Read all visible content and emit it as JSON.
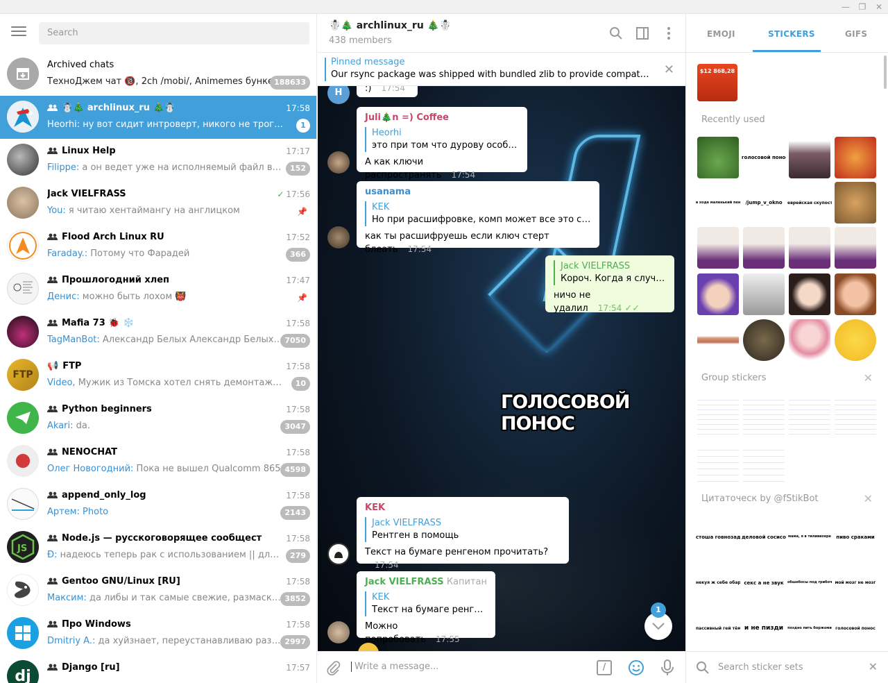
{
  "window": {
    "minimize": "—",
    "maximize": "❐",
    "close": "✕"
  },
  "search": {
    "placeholder": "Search"
  },
  "chats": [
    {
      "title": "Archived chats",
      "preview_sender": "",
      "preview": "ТехноДжем чат 🔞, 2ch /mobi/, Animemes бунке...",
      "time": "",
      "badge": "188633",
      "group": false
    },
    {
      "title": "☃️🎄 archlinux_ru 🎄☃️",
      "preview_sender": "",
      "preview": "Heorhi: ну вот сидит интроверт, никого не трогает. Чер...",
      "time": "17:58",
      "badge": "1",
      "group": true
    },
    {
      "title": "Linux Help",
      "preview_sender": "Filippe:",
      "preview": " а он ведет уже на исполняемый файл в папке ...",
      "time": "17:17",
      "badge": "152",
      "group": true
    },
    {
      "title": "Jack VIELFRASS",
      "preview_sender": "You:",
      "preview": " я читаю хентаймангу на англицком",
      "time": "17:56",
      "badge": "",
      "group": false
    },
    {
      "title": "Flood Arch Linux RU",
      "preview_sender": "Faraday.:",
      "preview": " Потому что Фарадей",
      "time": "17:52",
      "badge": "366",
      "group": true
    },
    {
      "title": "Прошлогодний хлеп",
      "preview_sender": "Денис:",
      "preview": " можно быть лохом 👹",
      "time": "17:47",
      "badge": "",
      "group": true
    },
    {
      "title": "Mafia 73 🐞 ❄️",
      "preview_sender": "TagManBot:",
      "preview": " Александр Белых Александр Белых  Anto...",
      "time": "17:58",
      "badge": "7050",
      "group": true
    },
    {
      "title": "FTP",
      "preview_sender": "Video,",
      "preview": " Мужик из Томска хотел снять демонтаж цемент...",
      "time": "17:58",
      "badge": "10",
      "group": false
    },
    {
      "title": "Python beginners",
      "preview_sender": "Akari:",
      "preview": " da.",
      "time": "17:58",
      "badge": "3047",
      "group": true
    },
    {
      "title": "NENOCHAT",
      "preview_sender": "Олег Новогодний:",
      "preview": " Пока не вышел Qualcomm 865",
      "time": "17:58",
      "badge": "4598",
      "group": true
    },
    {
      "title": "append_only_log",
      "preview_sender": "Артем:",
      "preview": " Photo",
      "time": "17:58",
      "badge": "2143",
      "group": true
    },
    {
      "title": "Node.js — русскоговорящее сообщество",
      "preview_sender": "Đ:",
      "preview": " надеюсь теперь рак с использованием || для знач...",
      "time": "17:58",
      "badge": "279",
      "group": true
    },
    {
      "title": "Gentoo GNU/Linux [RU]",
      "preview_sender": "Максим:",
      "preview": " да либы и так самые свежие, размаскирова...",
      "time": "17:58",
      "badge": "3852",
      "group": true
    },
    {
      "title": "Про Windows",
      "preview_sender": "Dmitriy A.:",
      "preview": " да хуйзнает, переустанавливаю раз в три ...",
      "time": "17:58",
      "badge": "2997",
      "group": true
    },
    {
      "title": "Django [ru]",
      "preview_sender": "",
      "preview": "",
      "time": "17:57",
      "badge": "",
      "group": true
    }
  ],
  "header": {
    "title": "☃️🎄 archlinux_ru 🎄☃️",
    "members": "438 members"
  },
  "pinned": {
    "title": "Pinned message",
    "text": "Our rsync package was shipped with bundled zlib to provide compatibility ..."
  },
  "messages": [
    {
      "from": "",
      "reply_name": "",
      "reply_text": "",
      "text": ":)",
      "time": "17:54"
    },
    {
      "from": "Juli🎄n =) Coffee",
      "reply_name": "Heorhi",
      "reply_text": "это при том что дурову особно ...",
      "text": "А как ключи распространять",
      "time": "17:54"
    },
    {
      "from": "usanama",
      "reply_name": "KEK",
      "reply_text": "Но при расшифровке, комп может все это сохра...",
      "text": "как ты расшифруешь если ключ стерт блеать",
      "time": "17:54"
    },
    {
      "from": "Jack VIELFRASS",
      "reply_name": "",
      "reply_text": "Короч. Когда я случай...",
      "text": "ничо не удалил",
      "time": "17:54",
      "ticks": "✓✓"
    },
    {
      "from": "KEK",
      "reply_name": "Jack VIELFRASS",
      "reply_text": "Рентген в помощь",
      "text": "Текст на бумаге ренгеном прочитать?",
      "time": "17:54"
    },
    {
      "from": "Jack VIELFRASS",
      "tag": "Капитан",
      "reply_name": "KEK",
      "reply_text": "Текст на бумаге ренгено...",
      "text": "Можно попробовать",
      "time": "17:55"
    }
  ],
  "sticker_caption": "ГОЛОСОВОЙ ПОНОС",
  "scroll_badge": "1",
  "composer": {
    "placeholder": "Write a message...",
    "command_glyph": "/"
  },
  "sticker_panel": {
    "tabs": [
      "EMOJI",
      "STICKERS",
      "GIFS"
    ],
    "top_sticker_text": "$12 868,28",
    "recently_used": "Recently used",
    "recent_texts": [
      "голосовой понос",
      "в ходе маленький пенис смотреть",
      "/jump_v_okno",
      "еврейская скупость"
    ],
    "group_stickers": "Group stickers",
    "citatochnik": "Цитаточеск by @fStikBot",
    "cit_texts": [
      "стоша говнозад",
      "деловой сосисон",
      "мама, я в тиливизере",
      "пиво сраками",
      "некуя ж себе обарбанк",
      "секс а не звук",
      "обшебосы под грибочками",
      "мой мозг не мозг",
      "пассивный гей тёма",
      "и не пизди",
      "поздно пить боржоми",
      "голосовой понос"
    ],
    "search_placeholder": "Search sticker sets"
  },
  "colors": {
    "accent": "#419fd9",
    "active_chat": "#419fd9",
    "badge": "#bbbbbb",
    "out_bubble": "#effdde",
    "name_red": "#c8466a",
    "name_green": "#4dae52"
  },
  "icons": [
    "menu-icon",
    "search-icon",
    "sidebar-toggle-icon",
    "more-icon",
    "close-icon",
    "attach-icon",
    "command-icon",
    "emoji-icon",
    "mic-icon",
    "group-icon",
    "pin-icon",
    "read-check-icon",
    "chevron-down-icon"
  ]
}
